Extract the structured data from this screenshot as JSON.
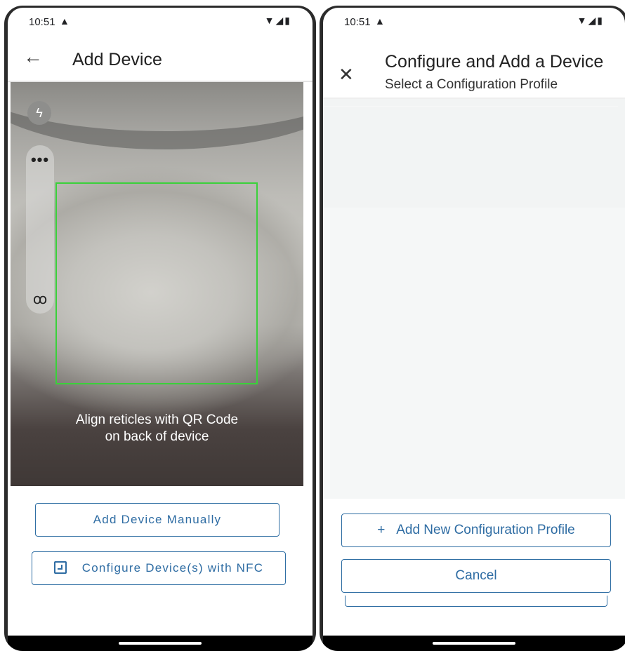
{
  "status_bar": {
    "time": "10:51",
    "warning_icon": "warning-triangle-icon",
    "wifi_icon": "wifi-icon",
    "signal_icon": "signal-icon",
    "battery_icon": "battery-icon"
  },
  "left_screen": {
    "title": "Add Device",
    "back_icon": "arrow-left-icon",
    "camera": {
      "flash_icon": "flash-icon",
      "more_icon": "more-horizontal-icon",
      "tracking_icon": "tracking-off-icon",
      "reticle_color": "#3ad13a",
      "hint_line1": "Align reticles with QR Code",
      "hint_line2": "on back of device"
    },
    "add_manually_label": "Add Device Manually",
    "nfc_label": "Configure Device(s) with NFC",
    "nfc_icon": "nfc-icon"
  },
  "right_screen": {
    "close_icon": "close-icon",
    "title": "Configure and Add a Device",
    "subtitle": "Select a Configuration Profile",
    "add_profile_label": "Add New Configuration Profile",
    "add_icon": "plus-icon",
    "cancel_label": "Cancel"
  },
  "colors": {
    "accent": "#2e6ca3",
    "reticle": "#3ad13a",
    "content_bg": "#f5f7f7"
  }
}
